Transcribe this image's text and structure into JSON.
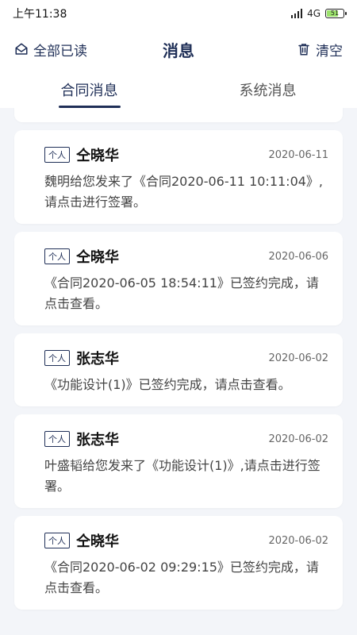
{
  "status": {
    "time": "上午11:38",
    "network": "4G",
    "battery": "51"
  },
  "header": {
    "mark_all_read": "全部已读",
    "title": "消息",
    "clear": "清空"
  },
  "tabs": [
    {
      "label": "合同消息",
      "active": true
    },
    {
      "label": "系统消息",
      "active": false
    }
  ],
  "messages": [
    {
      "badge": "个人",
      "sender": "仝晓华",
      "date": "2020-06-11",
      "text": "魏明给您发来了《合同2020-06-11 10:11:04》,请点击进行签署。"
    },
    {
      "badge": "个人",
      "sender": "仝晓华",
      "date": "2020-06-06",
      "text": "《合同2020-06-05 18:54:11》已签约完成，请点击查看。"
    },
    {
      "badge": "个人",
      "sender": "张志华",
      "date": "2020-06-02",
      "text": "《功能设计(1)》已签约完成，请点击查看。"
    },
    {
      "badge": "个人",
      "sender": "张志华",
      "date": "2020-06-02",
      "text": "叶盛韬给您发来了《功能设计(1)》,请点击进行签署。"
    },
    {
      "badge": "个人",
      "sender": "仝晓华",
      "date": "2020-06-02",
      "text": "《合同2020-06-02 09:29:15》已签约完成，请点击查看。"
    }
  ]
}
